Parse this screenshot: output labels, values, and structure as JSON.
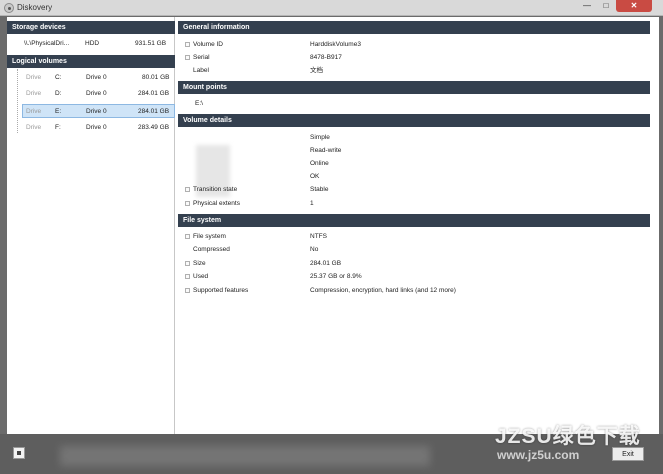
{
  "window": {
    "title": "Diskovery",
    "min_glyph": "—",
    "max_glyph": "□",
    "close_glyph": "✕"
  },
  "left": {
    "storage_header": "Storage devices",
    "device": {
      "name": "\\\\.\\PhysicalDri...",
      "type": "HDD",
      "size": "931.51 GB"
    },
    "logical_header": "Logical volumes",
    "volumes": [
      {
        "kind": "Drive",
        "letter": "C:",
        "drive": "Drive 0",
        "size": "80.01 GB"
      },
      {
        "kind": "Drive",
        "letter": "D:",
        "drive": "Drive 0",
        "size": "284.01 GB"
      },
      {
        "kind": "Drive",
        "letter": "E:",
        "drive": "Drive 0",
        "size": "284.01 GB"
      },
      {
        "kind": "Drive",
        "letter": "F:",
        "drive": "Drive 0",
        "size": "283.49 GB"
      }
    ]
  },
  "right": {
    "general": {
      "header": "General information",
      "rows": [
        {
          "key": "Volume ID",
          "value": "HarddiskVolume3"
        },
        {
          "key": "Serial",
          "value": "8478-B917"
        },
        {
          "key": "Label",
          "value": "文档"
        }
      ]
    },
    "mount": {
      "header": "Mount points",
      "path": "E:\\"
    },
    "volume_details": {
      "header": "Volume details",
      "rows": [
        {
          "key": "",
          "value": "Simple"
        },
        {
          "key": "",
          "value": "Read-write"
        },
        {
          "key": "",
          "value": "Online"
        },
        {
          "key": "",
          "value": "OK"
        },
        {
          "key": "Transition state",
          "value": "Stable"
        },
        {
          "key": "Physical extents",
          "value": "1"
        }
      ]
    },
    "file_system": {
      "header": "File system",
      "rows": [
        {
          "key": "File system",
          "value": "NTFS"
        },
        {
          "key": "Compressed",
          "value": "No"
        },
        {
          "key": "Size",
          "value": "284.01 GB"
        },
        {
          "key": "Used",
          "value": "25.37 GB  or  8.9%"
        },
        {
          "key": "Supported features",
          "value": "Compression, encryption, hard links (and 12 more)"
        }
      ]
    }
  },
  "status": {
    "exit_label": "Exit"
  },
  "watermark": {
    "main": "JZSU绿色下载",
    "sub": "www.jz5u.com"
  }
}
